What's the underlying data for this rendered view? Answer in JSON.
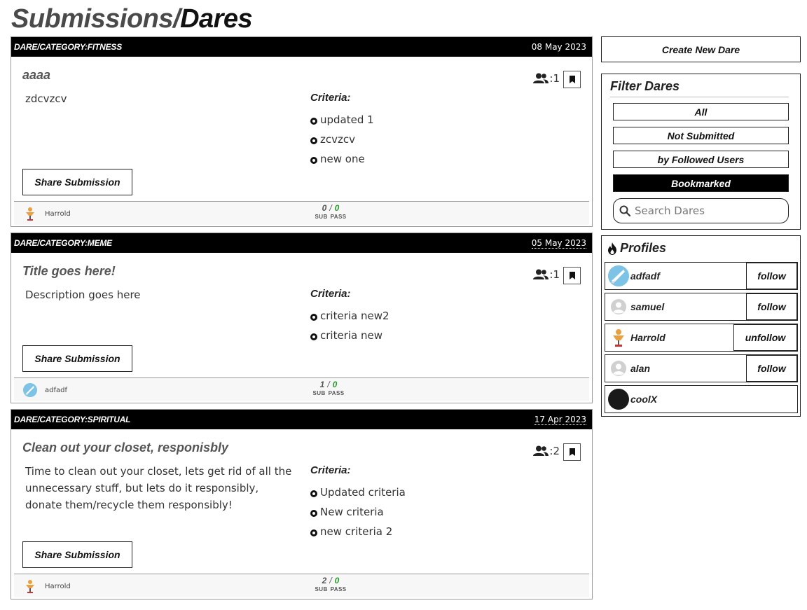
{
  "header": {
    "crumb": "Submissions/",
    "current": "Dares"
  },
  "dares": [
    {
      "category": "DARE/CATEGORY:FITNESS",
      "date": "08 May 2023",
      "title": "aaaa",
      "description": "zdcvzcv",
      "participants": "1",
      "criteria_title": "Criteria:",
      "criteria": [
        "updated 1",
        "zcvzcv",
        "new one"
      ],
      "share_label": "Share Submission",
      "author": "Harrold",
      "sub": "0",
      "pass": "0",
      "sub_label": "SUB",
      "pass_label": "PASS"
    },
    {
      "category": "DARE/CATEGORY:MEME",
      "date": "05 May 2023",
      "title": "Title goes here!",
      "description": "Description goes here",
      "participants": "1",
      "criteria_title": "Criteria:",
      "criteria": [
        "criteria new2",
        "criteria new"
      ],
      "share_label": "Share Submission",
      "author": "adfadf",
      "sub": "1",
      "pass": "0",
      "sub_label": "SUB",
      "pass_label": "PASS"
    },
    {
      "category": "DARE/CATEGORY:SPIRITUAL",
      "date": "17 Apr 2023",
      "title": "Clean out your closet, responisbly",
      "description": "Time to clean out your closet, lets get rid of all the unnecessary stuff, but lets do it responsibly, donate them/recycle them responsibly!",
      "participants": "2",
      "criteria_title": "Criteria:",
      "criteria": [
        "Updated criteria",
        "New criteria",
        "new criteria 2"
      ],
      "share_label": "Share Submission",
      "author": "Harrold",
      "sub": "2",
      "pass": "0",
      "sub_label": "SUB",
      "pass_label": "PASS"
    }
  ],
  "sidebar": {
    "create_label": "Create New Dare",
    "filter_title": "Filter Dares",
    "filters": [
      "All",
      "Not Submitted",
      "by Followed Users",
      "Bookmarked"
    ],
    "active_filter": "Bookmarked",
    "search_placeholder": "Search Dares",
    "profiles_title": "Profiles",
    "profiles": [
      {
        "name": "adfadf",
        "action": "follow",
        "avatar": "photo-avatar-blue"
      },
      {
        "name": "samuel",
        "action": "follow",
        "avatar": "default-avatar"
      },
      {
        "name": "Harrold",
        "action": "unfollow",
        "avatar": "figure-avatar"
      },
      {
        "name": "alan",
        "action": "follow",
        "avatar": "default-avatar"
      },
      {
        "name": "coolX",
        "action": "",
        "avatar": "dark-avatar"
      }
    ]
  },
  "colors": {
    "header_bg": "#000000",
    "pass_green": "#2a9d2a",
    "text_gray": "#555555"
  }
}
